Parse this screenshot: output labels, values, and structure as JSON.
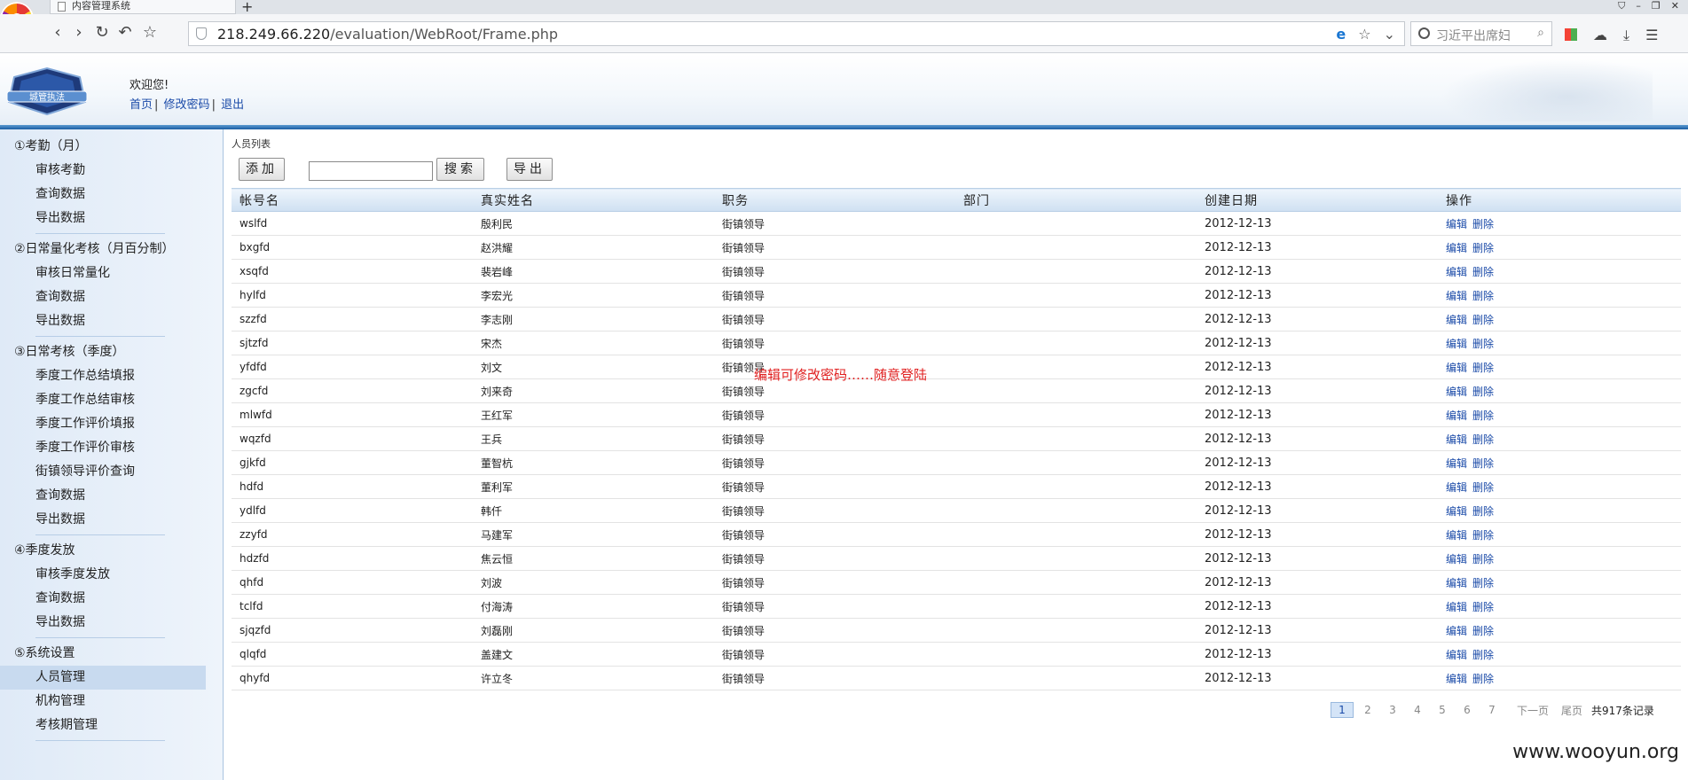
{
  "browser": {
    "tab_title": "内容管理系统",
    "new_tab": "+",
    "url_host": "218.249.66.220",
    "url_path": "/evaluation/WebRoot/Frame.php",
    "search_placeholder": "习近平出席妇"
  },
  "header": {
    "logo_text": "城管执法",
    "welcome": "欢迎您!",
    "links": [
      "首页",
      "修改密码",
      "退出"
    ]
  },
  "sidebar": {
    "groups": [
      {
        "title": "①考勤（月）",
        "items": [
          "审核考勤",
          "查询数据",
          "导出数据"
        ]
      },
      {
        "title": "②日常量化考核（月百分制）",
        "items": [
          "审核日常量化",
          "查询数据",
          "导出数据"
        ]
      },
      {
        "title": "③日常考核（季度）",
        "items": [
          "季度工作总结填报",
          "季度工作总结审核",
          "季度工作评价填报",
          "季度工作评价审核",
          "街镇领导评价查询",
          "查询数据",
          "导出数据"
        ]
      },
      {
        "title": "④季度发放",
        "items": [
          "审核季度发放",
          "查询数据",
          "导出数据"
        ]
      },
      {
        "title": "⑤系统设置",
        "items": [
          "人员管理",
          "机构管理",
          "考核期管理"
        ]
      }
    ],
    "active_item": "人员管理"
  },
  "main": {
    "breadcrumb": "人员列表",
    "add_button": "添加",
    "search_button": "搜索",
    "export_button": "导出",
    "search_value": "",
    "columns": [
      "帐号名",
      "真实姓名",
      "职务",
      "部门",
      "创建日期",
      "操作"
    ],
    "edit_label": "编辑",
    "delete_label": "删除",
    "rows": [
      {
        "account": "wslfd",
        "name": "殷利民",
        "position": "街镇领导",
        "dept": "",
        "date": "2012-12-13"
      },
      {
        "account": "bxgfd",
        "name": "赵洪耀",
        "position": "街镇领导",
        "dept": "",
        "date": "2012-12-13"
      },
      {
        "account": "xsqfd",
        "name": "裴岩峰",
        "position": "街镇领导",
        "dept": "",
        "date": "2012-12-13"
      },
      {
        "account": "hylfd",
        "name": "李宏光",
        "position": "街镇领导",
        "dept": "",
        "date": "2012-12-13"
      },
      {
        "account": "szzfd",
        "name": "李志刚",
        "position": "街镇领导",
        "dept": "",
        "date": "2012-12-13"
      },
      {
        "account": "sjtzfd",
        "name": "宋杰",
        "position": "街镇领导",
        "dept": "",
        "date": "2012-12-13"
      },
      {
        "account": "yfdfd",
        "name": "刘文",
        "position": "街镇领导",
        "dept": "",
        "date": "2012-12-13"
      },
      {
        "account": "zgcfd",
        "name": "刘来奇",
        "position": "街镇领导",
        "dept": "",
        "date": "2012-12-13"
      },
      {
        "account": "mlwfd",
        "name": "王红军",
        "position": "街镇领导",
        "dept": "",
        "date": "2012-12-13"
      },
      {
        "account": "wqzfd",
        "name": "王兵",
        "position": "街镇领导",
        "dept": "",
        "date": "2012-12-13"
      },
      {
        "account": "gjkfd",
        "name": "董智杭",
        "position": "街镇领导",
        "dept": "",
        "date": "2012-12-13"
      },
      {
        "account": "hdfd",
        "name": "董利军",
        "position": "街镇领导",
        "dept": "",
        "date": "2012-12-13"
      },
      {
        "account": "ydlfd",
        "name": "韩仟",
        "position": "街镇领导",
        "dept": "",
        "date": "2012-12-13"
      },
      {
        "account": "zzyfd",
        "name": "马建军",
        "position": "街镇领导",
        "dept": "",
        "date": "2012-12-13"
      },
      {
        "account": "hdzfd",
        "name": "焦云恒",
        "position": "街镇领导",
        "dept": "",
        "date": "2012-12-13"
      },
      {
        "account": "qhfd",
        "name": "刘波",
        "position": "街镇领导",
        "dept": "",
        "date": "2012-12-13"
      },
      {
        "account": "tclfd",
        "name": "付海涛",
        "position": "街镇领导",
        "dept": "",
        "date": "2012-12-13"
      },
      {
        "account": "sjqzfd",
        "name": "刘磊刚",
        "position": "街镇领导",
        "dept": "",
        "date": "2012-12-13"
      },
      {
        "account": "qlqfd",
        "name": "盖建文",
        "position": "街镇领导",
        "dept": "",
        "date": "2012-12-13"
      },
      {
        "account": "qhyfd",
        "name": "许立冬",
        "position": "街镇领导",
        "dept": "",
        "date": "2012-12-13"
      }
    ],
    "annotation": "编辑可修改密码……随意登陆",
    "pagination": {
      "pages": [
        "1",
        "2",
        "3",
        "4",
        "5",
        "6",
        "7"
      ],
      "current": "1",
      "next": "下一页",
      "last": "尾页",
      "total": "共917条记录"
    }
  },
  "watermark": "www.wooyun.org"
}
